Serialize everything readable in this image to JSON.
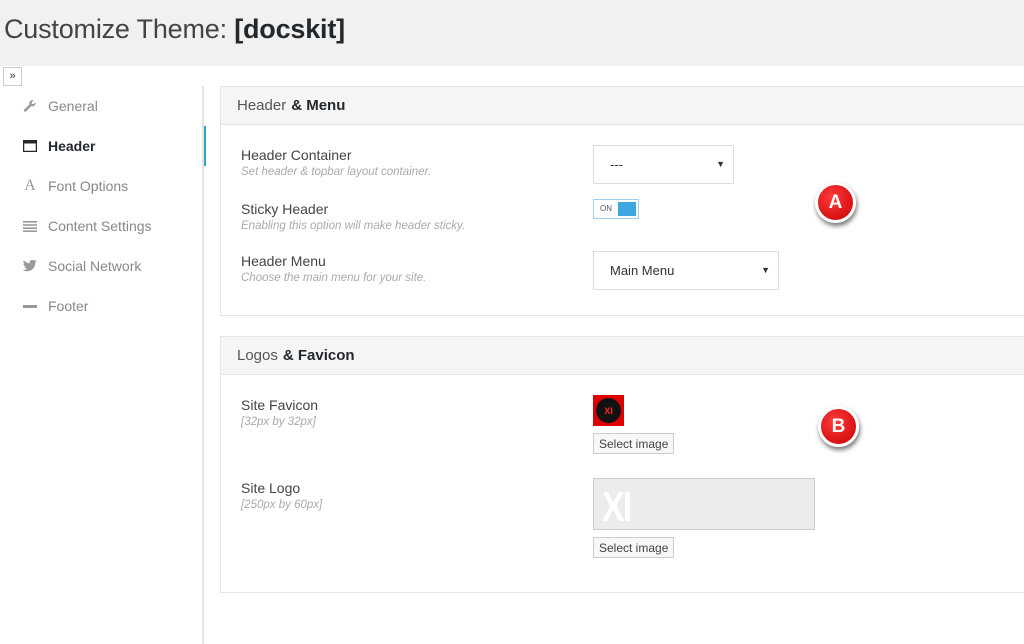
{
  "page": {
    "title_prefix": "Customize Theme:",
    "theme_name": "[docskit]"
  },
  "collapse": {
    "label": "»"
  },
  "sidebar": {
    "items": [
      {
        "label": "General",
        "icon": "wrench-icon",
        "glyph": "🔧"
      },
      {
        "label": "Header",
        "icon": "window-icon",
        "glyph": "▬"
      },
      {
        "label": "Font Options",
        "icon": "font-icon",
        "glyph": "A"
      },
      {
        "label": "Content Settings",
        "icon": "list-icon",
        "glyph": "≡"
      },
      {
        "label": "Social Network",
        "icon": "twitter-icon",
        "glyph": "🐦"
      },
      {
        "label": "Footer",
        "icon": "minus-icon",
        "glyph": "▬"
      }
    ],
    "active_index": 1
  },
  "header_panel": {
    "title_light": "Header",
    "title_strong": "& Menu",
    "fields": {
      "container": {
        "label": "Header Container",
        "desc": "Set header & topbar layout container.",
        "value": "---"
      },
      "sticky": {
        "label": "Sticky Header",
        "desc": "Enabling this option will make header sticky.",
        "toggle_text": "ON"
      },
      "menu": {
        "label": "Header Menu",
        "desc": "Choose the main menu for your site.",
        "value": "Main Menu"
      }
    },
    "badge": "A"
  },
  "logos_panel": {
    "title_light": "Logos",
    "title_strong": "& Favicon",
    "fields": {
      "favicon": {
        "label": "Site Favicon",
        "desc": "[32px by 32px]",
        "preview_text": "XI",
        "button": "Select image"
      },
      "logo": {
        "label": "Site Logo",
        "desc": "[250px by 60px]",
        "preview_text": "XI",
        "button": "Select image"
      }
    },
    "badge": "B"
  },
  "colors": {
    "accent": "#2ea2cc",
    "badge_red": "#d40000",
    "toggle_on": "#3ba7de"
  }
}
